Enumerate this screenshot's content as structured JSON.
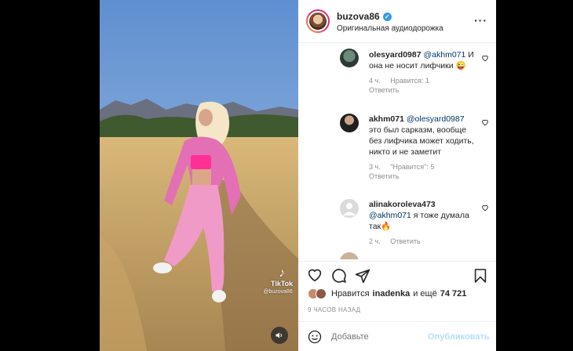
{
  "post": {
    "username": "buzova86",
    "audio": "Оригинальная аудиодорожка",
    "more_icon": "more-horizontal-icon"
  },
  "video": {
    "watermark_brand": "TikTok",
    "watermark_user": "@buzova86"
  },
  "comments": [
    {
      "user": "olesyard0987",
      "mention": "@akhm071",
      "text": "И она не носит лифчики 😜",
      "time": "4 ч.",
      "likes": "Нравится: 1",
      "reply": "Ответить"
    },
    {
      "user": "akhm071",
      "mention": "@olesyard0987",
      "text": "это был сарказм, вообще без лифчика может ходить, никто и не заметит",
      "time": "3 ч.",
      "likes": "\"Нравится\": 5",
      "reply": "Ответить"
    },
    {
      "user": "alinakoroleva473",
      "mention": "@akhm071",
      "text": "я тоже думала так🔥",
      "time": "2 ч.",
      "likes": "",
      "reply": "Ответить"
    }
  ],
  "likes": {
    "prefix": "Нравится",
    "user": "inadenka",
    "suffix": "и ещё",
    "count": "74 721"
  },
  "timestamp": "9 ЧАСОВ НАЗАД",
  "add_comment": {
    "placeholder": "Добавьте",
    "publish_label": "Опубликовать"
  },
  "colors": {
    "verified": "#3897f0",
    "mention": "#00376b",
    "muted": "#8e8e8e",
    "publish_disabled": "#b2dffc"
  }
}
